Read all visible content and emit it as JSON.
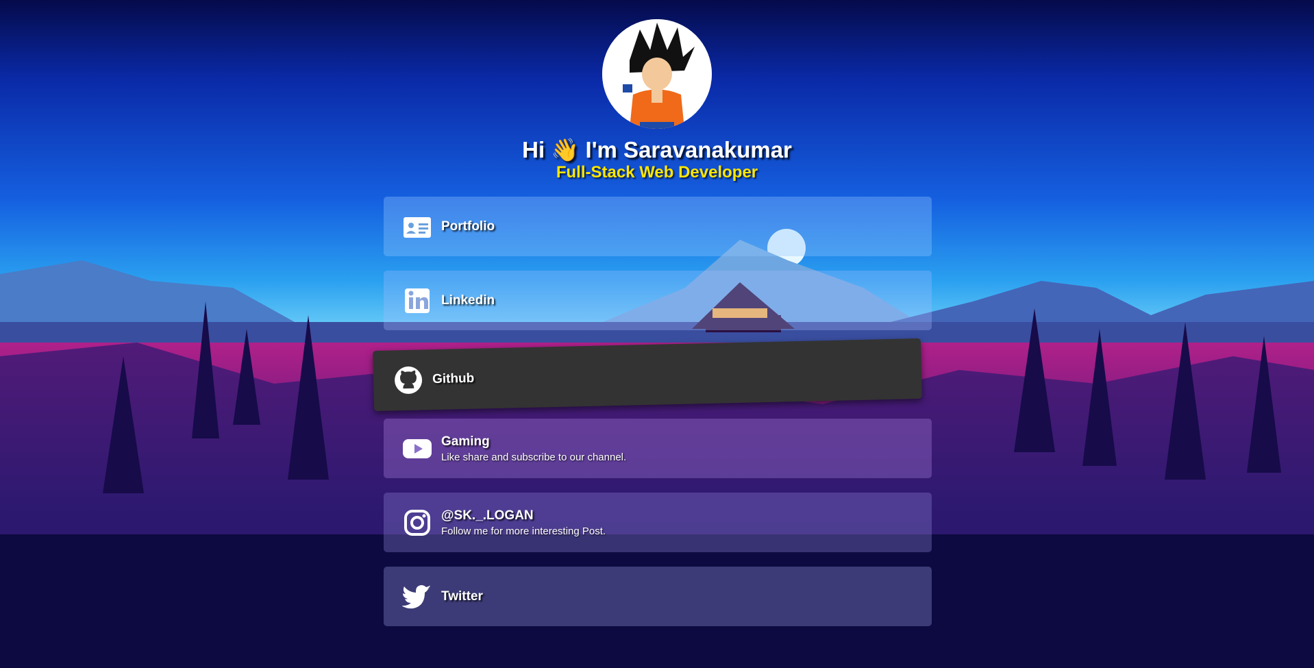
{
  "profile": {
    "greeting": "Hi 👋 I'm Saravanakumar",
    "role": "Full-Stack Web Developer",
    "avatar_icon": "goku-avatar"
  },
  "links": [
    {
      "label": "Portfolio",
      "icon": "id-card-icon"
    },
    {
      "label": "Linkedin",
      "icon": "linkedin-icon"
    },
    {
      "label": "Github",
      "icon": "github-icon"
    },
    {
      "label": "Gaming",
      "sub": "Like share and subscribe to our channel.",
      "icon": "youtube-icon"
    },
    {
      "label": "@SK._.LOGAN",
      "sub": "Follow me for more interesting Post.",
      "icon": "instagram-icon"
    },
    {
      "label": "Twitter",
      "icon": "twitter-icon"
    }
  ],
  "colors": {
    "role": "#ffe600",
    "github_card": "#333333"
  }
}
